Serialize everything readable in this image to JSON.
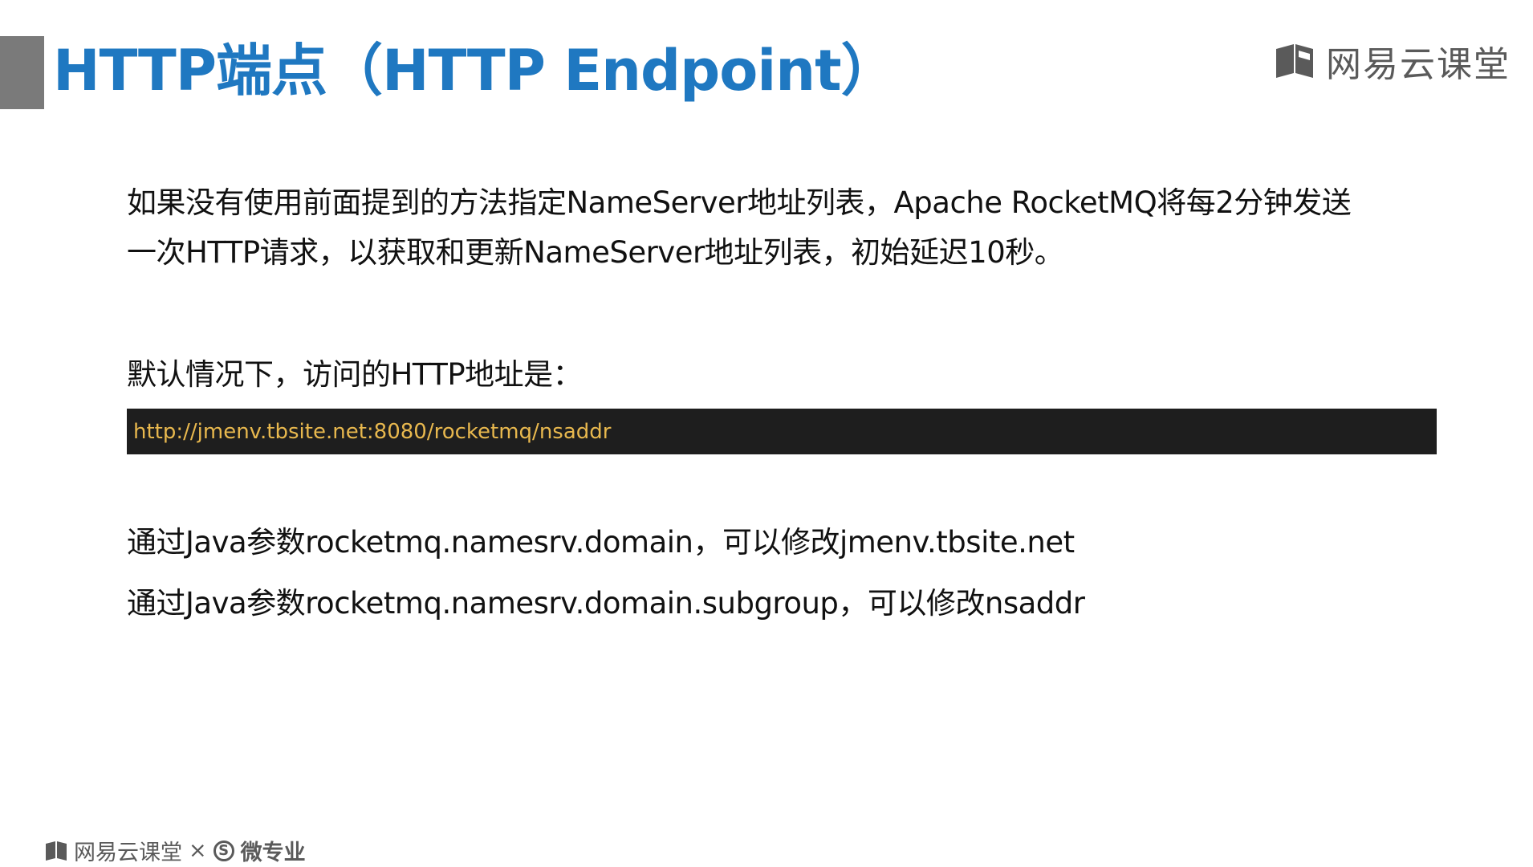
{
  "header": {
    "title": "HTTP端点（HTTP Endpoint）",
    "brand_name": "网易云课堂",
    "brand_icon": "book-icon"
  },
  "content": {
    "paragraph_1_line_1": "如果没有使用前面提到的方法指定NameServer地址列表，Apache RocketMQ将每2分钟发送",
    "paragraph_1_line_2": "一次HTTP请求，以获取和更新NameServer地址列表，初始延迟10秒。",
    "default_label": "默认情况下，访问的HTTP地址是：",
    "code_url": "http://jmenv.tbsite.net:8080/rocketmq/nsaddr",
    "domain_note": "通过Java参数rocketmq.namesrv.domain，可以修改jmenv.tbsite.net",
    "subgroup_note": "通过Java参数rocketmq.namesrv.domain.subgroup，可以修改nsaddr"
  },
  "footer": {
    "brand_name": "网易云课堂",
    "separator": "×",
    "partner_symbol": "S",
    "partner_name": "微专业"
  },
  "colors": {
    "title": "#1f78c1",
    "accent_bar": "#7a7a7a",
    "code_bg": "#1e1e1e",
    "code_text": "#e8b84e"
  }
}
